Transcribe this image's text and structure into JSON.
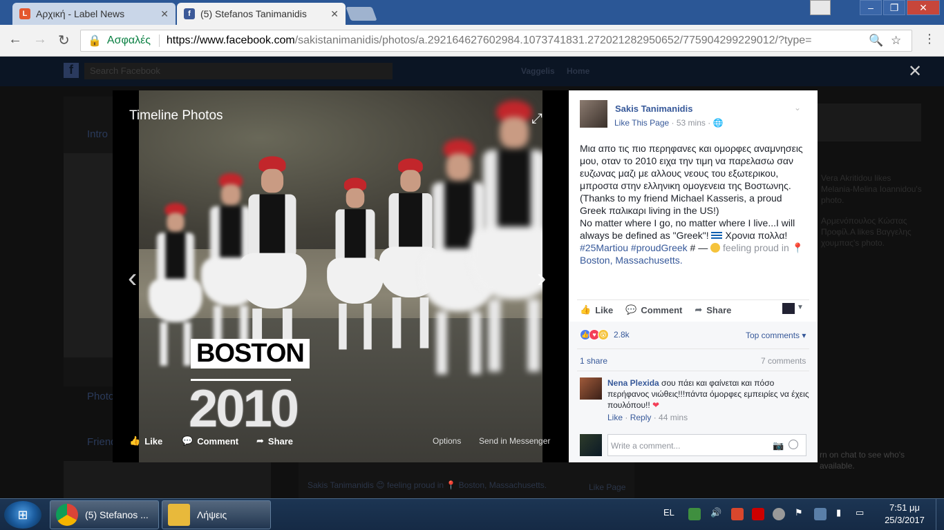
{
  "browser": {
    "tabs": [
      {
        "label": "Αρχική - Label News",
        "favicon": "L"
      },
      {
        "label": "(5) Stefanos Tanimanidis",
        "favicon": "f"
      }
    ],
    "secure_label": "Ασφαλές",
    "url_main": "https://www.facebook.com",
    "url_rest": "/sakistanimanidis/photos/a.292164627602984.1073741831.272021282950652/775904299229012/?type="
  },
  "fb_background": {
    "search_placeholder": "Search Facebook",
    "nav_user": "Vaggelis",
    "nav_home": "Home",
    "intro": "Intro",
    "photos": "Photos",
    "friends": "Friends",
    "story": "Sakis Tanimanidis 😊 feeling proud in 📍 Boston, Massachusetts.",
    "like_page": "Like Page",
    "ticker1": "Vera Akritidou likes Melania-Melina Ioannidou's photo.",
    "ticker2": "Αρμενόπουλος Κώστας Προφίλ.Α likes Βαγγελης χουμπας's photo.",
    "chat_hint": "rn on chat to see who's available."
  },
  "viewer": {
    "title": "Timeline Photos",
    "overlay_text_top": "BOSTON",
    "overlay_text_bottom": "2010",
    "like": "Like",
    "comment": "Comment",
    "share": "Share",
    "options": "Options",
    "send": "Send in Messenger"
  },
  "panel": {
    "author": "Sakis Tanimanidis",
    "like_page": "Like This Page",
    "time": "53 mins",
    "post_lines": [
      "Μια απο τις πιο περηφανες και ομορφες αναμνησεις μου, οταν το 2010 ειχα την τιμη να παρελασω σαν ευζωνας μαζι με αλλους νεους του εξωτερικου, μπροστα στην ελληνικη ομογενεια της Βοστωνης.",
      "(Thanks to my friend Michael Kasseris, a proud Greek παλικαρι living in the US!)",
      "No matter where I go, no matter where I live...I will always be defined as \"Greek\"!"
    ],
    "post_greek_wish": "Χρονια πολλα!",
    "hashtags": "#25Martiou #proudGreek",
    "hash_suffix": "# —",
    "feeling": "feeling proud in",
    "location": "Boston, Massachusetts.",
    "action_like": "Like",
    "action_comment": "Comment",
    "action_share": "Share",
    "reactions_count": "2.8k",
    "top_comments": "Top comments",
    "shares": "1 share",
    "comments_count": "7 comments",
    "comment_author": "Nena Plexida",
    "comment_text": "σου πάει και φαίνεται και πόσο περήφανος νιώθεις!!!πάντα όμορφες εμπειρίες να έχεις πουλόπου!!",
    "comment_like": "Like",
    "comment_reply": "Reply",
    "comment_time": "44 mins",
    "write_placeholder": "Write a comment..."
  },
  "taskbar": {
    "chrome_label": "(5) Stefanos ...",
    "folder_label": "Λήψεις",
    "lang": "EL",
    "time": "7:51 μμ",
    "date": "25/3/2017"
  }
}
